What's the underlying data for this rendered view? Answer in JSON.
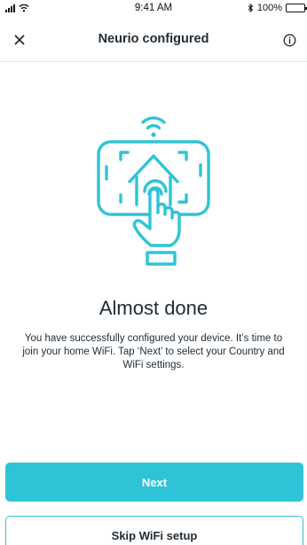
{
  "status_bar": {
    "time": "9:41 AM",
    "battery": "100%",
    "icons": [
      "signal-icon",
      "wifi-icon",
      "bluetooth-icon",
      "battery-icon"
    ]
  },
  "nav": {
    "title": "Neurio configured",
    "close_icon": "close-icon",
    "info_icon": "info-icon"
  },
  "illustration": {
    "icon": "phone-home-tap-wifi-illustration",
    "color": "#2ec4d8"
  },
  "content": {
    "heading": "Almost done",
    "body": "You have successfully configured your device. It’s time to join your home WiFi. Tap ‘Next’ to select your Country and WiFi settings."
  },
  "actions": {
    "next_label": "Next",
    "skip_label": "Skip WiFi setup"
  },
  "colors": {
    "accent": "#2ec4d8",
    "text": "#1f2a33",
    "divider": "#e2e6ea"
  }
}
